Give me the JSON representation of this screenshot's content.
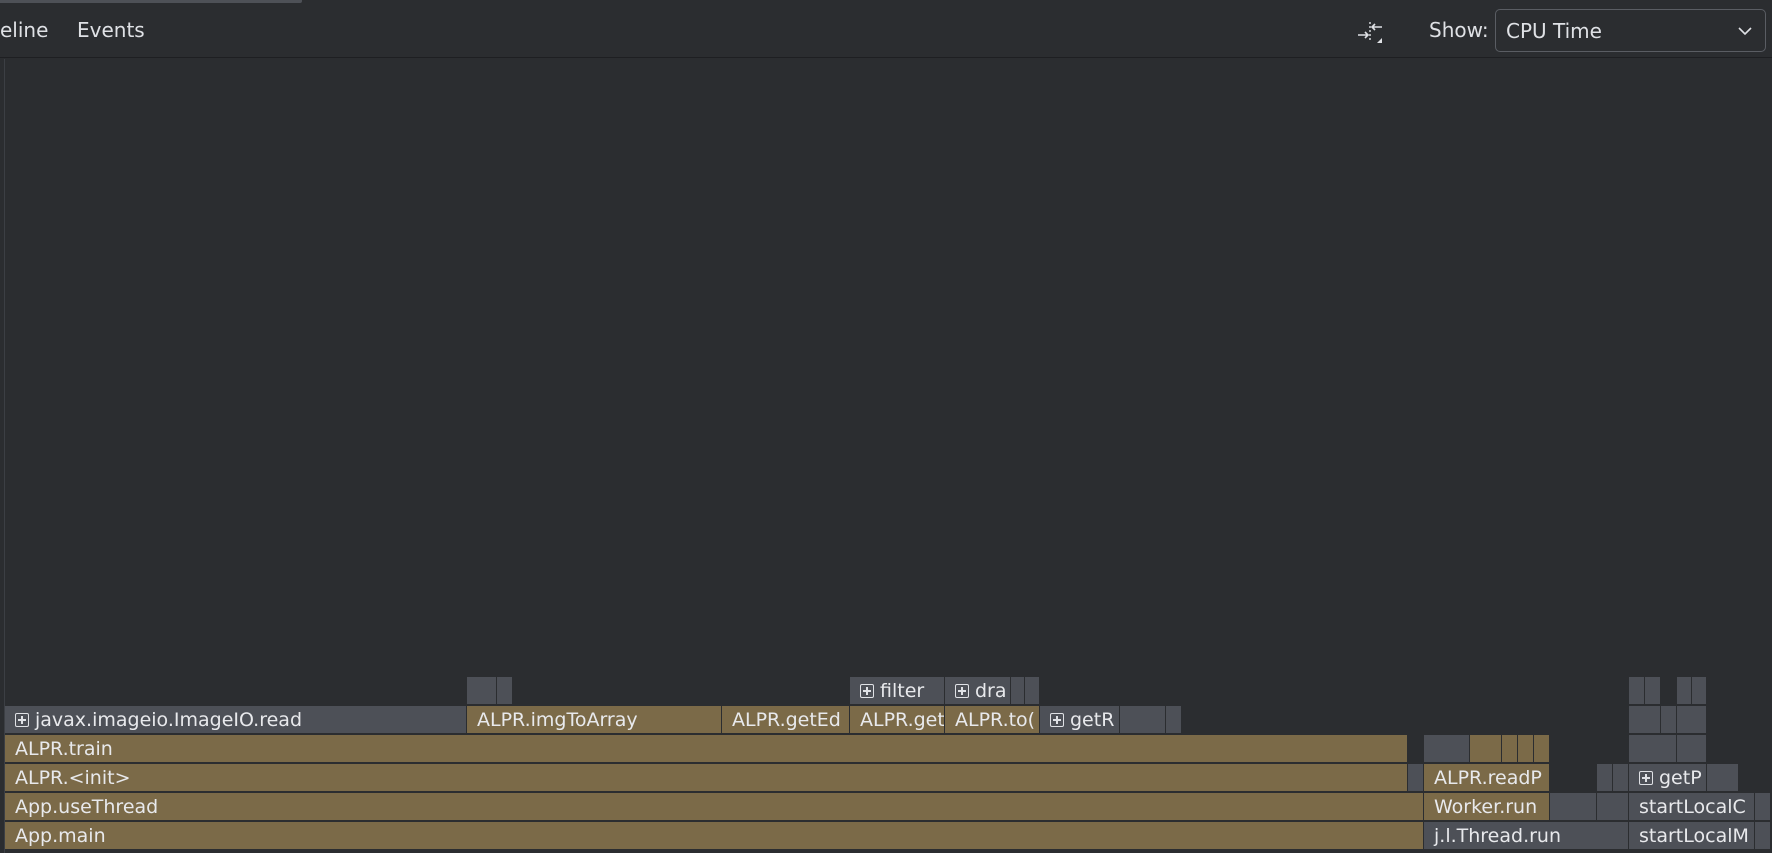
{
  "toolbar": {
    "tabs": {
      "timeline": "eline",
      "events": "Events"
    },
    "collapse_icon": "collapse-arrows-icon",
    "show_label": "Show:",
    "show_value": "CPU Time",
    "dropdown_icon": "chevron-down-icon"
  },
  "flame": {
    "row1": {
      "imageio_read": "javax.imageio.ImageIO.read",
      "img_to_array": "ALPR.imgToArray",
      "get_edges": "ALPR.getEd",
      "get": "ALPR.get",
      "to": "ALPR.to(",
      "get_r": "getR"
    },
    "row0": {
      "filter": "filter",
      "dra": "dra"
    },
    "train": "ALPR.train",
    "init": "ALPR.<init>",
    "use_thread": "App.useThread",
    "main": "App.main",
    "read_p": "ALPR.readP",
    "worker_run": "Worker.run",
    "thread_run": "j.l.Thread.run",
    "get_p": "getP",
    "start_local_c": "startLocalC",
    "start_local_m": "startLocalM"
  },
  "colors": {
    "frame_gold": "#7b6a48",
    "frame_gray": "#4d5057",
    "background": "#2b2d30"
  }
}
